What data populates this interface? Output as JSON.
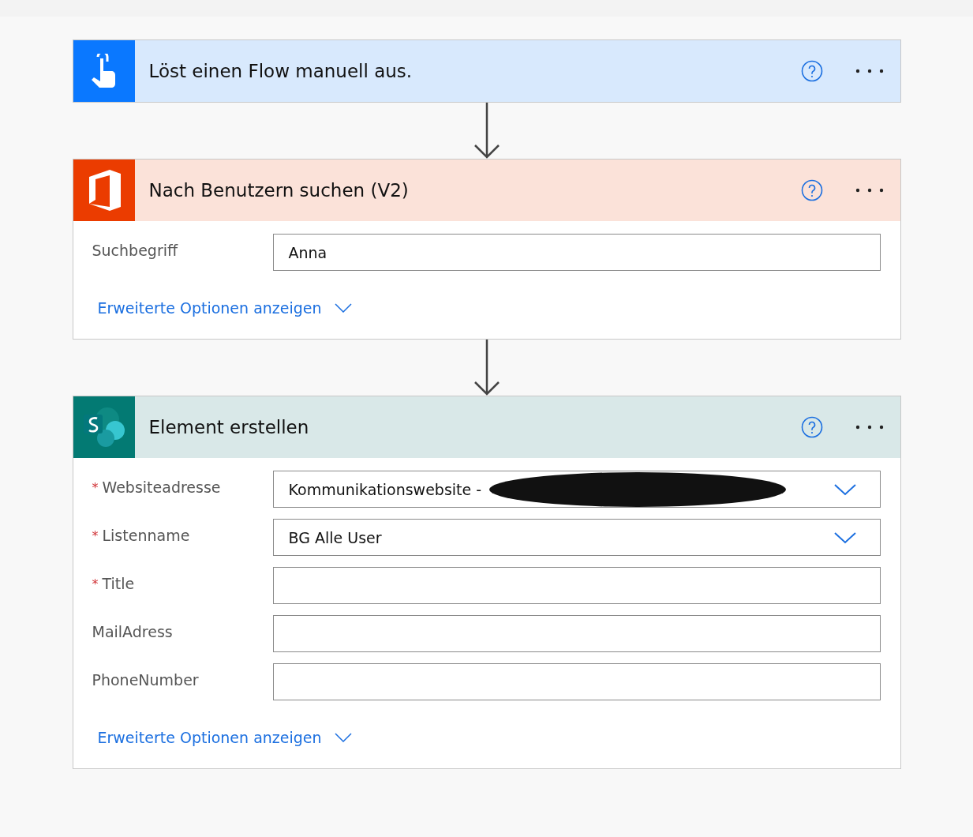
{
  "steps": [
    {
      "kind": "manual",
      "title": "Löst einen Flow manuell aus."
    },
    {
      "kind": "office",
      "title": "Nach Benutzern suchen (V2)",
      "fields": [
        {
          "label": "Suchbegriff",
          "value": "Anna",
          "dropdown": false
        }
      ],
      "link": "Erweiterte Optionen anzeigen"
    },
    {
      "kind": "sharepoint",
      "title": "Element erstellen",
      "fields": [
        {
          "required_mark": "*",
          "label": "Websiteadresse",
          "value": "Kommunikationswebsite -",
          "dropdown": true,
          "redacted": true
        },
        {
          "required_mark": "*",
          "label": "Listenname",
          "value": "BG Alle User",
          "dropdown": true
        },
        {
          "required_mark": "*",
          "label": "Title"
        },
        {
          "label": "MailAdress"
        },
        {
          "label": "PhoneNumber"
        }
      ],
      "link": "Erweiterte Optionen anzeigen"
    }
  ]
}
